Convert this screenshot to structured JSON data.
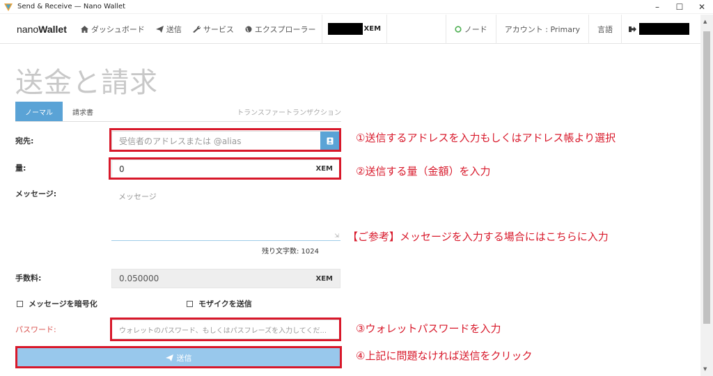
{
  "window": {
    "title": "Send & Receive — Nano Wallet"
  },
  "nav": {
    "brand_light": "nano",
    "brand_bold": "Wallet",
    "dashboard": "ダッシュボード",
    "send": "送信",
    "services": "サービス",
    "explorer": "エクスプローラー",
    "balance_unit": "XEM",
    "node": "ノード",
    "account": "アカウント : Primary",
    "language": "言語"
  },
  "page": {
    "title": "送金と請求"
  },
  "tabs": {
    "normal": "ノーマル",
    "invoice": "請求書",
    "transfer_tx": "トランスファートランザクション"
  },
  "form": {
    "recipient_label": "宛先:",
    "recipient_placeholder": "受信者のアドレスまたは @alias",
    "amount_label": "量:",
    "amount_value": "0",
    "amount_unit": "XEM",
    "message_label": "メッセージ:",
    "message_placeholder": "メッセージ",
    "chars_left": "残り文字数: 1024",
    "fee_label": "手数料:",
    "fee_value": "0.050000",
    "fee_unit": "XEM",
    "encrypt_label": "メッセージを暗号化",
    "mosaic_label": "モザイクを送信",
    "password_label": "パスワード:",
    "password_placeholder": "ウォレットのパスワード、もしくはパスフレーズを入力してくだ...",
    "send_label": "送信"
  },
  "annotations": {
    "a1": "①送信するアドレスを入力もしくはアドレス帳より選択",
    "a2": "②送信する量（金額）を入力",
    "a_msg": "【ご参考】メッセージを入力する場合にはこちらに入力",
    "a3": "③ウォレットパスワードを入力",
    "a4": "④上記に問題なければ送信をクリック"
  },
  "colors": {
    "accent": "#5aa3d6",
    "annotation": "#d8182a",
    "send_button": "#98c8ec"
  }
}
